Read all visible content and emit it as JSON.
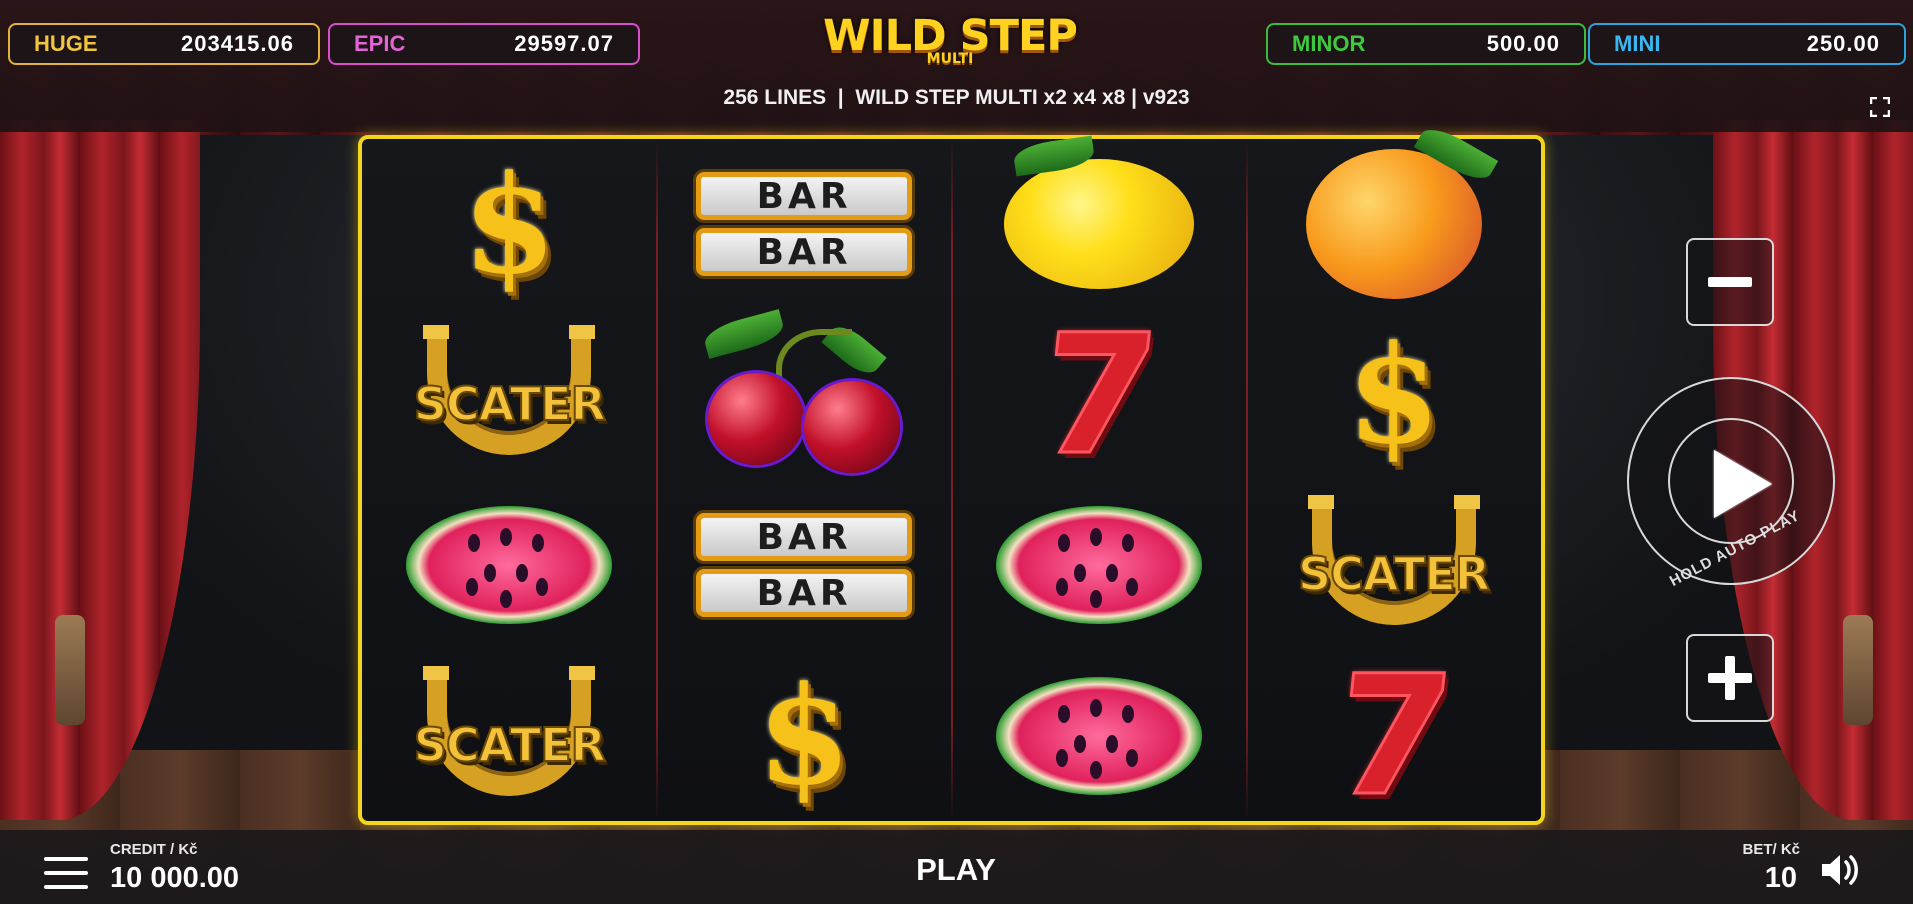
{
  "jackpots": {
    "huge": {
      "label": "HUGE",
      "value": "203415.06"
    },
    "epic": {
      "label": "EPIC",
      "value": "29597.07"
    },
    "minor": {
      "label": "MINOR",
      "value": "500.00"
    },
    "mini": {
      "label": "MINI",
      "value": "250.00"
    }
  },
  "logo": {
    "main": "WILD STEP",
    "sub": "MULTI"
  },
  "info_line": "256 LINES  |  WILD STEP MULTI x2 x4 x8 | v923",
  "grid": [
    [
      "dollar",
      "bar",
      "lemon",
      "orange"
    ],
    [
      "scatter",
      "cherry",
      "seven",
      "dollar"
    ],
    [
      "watermelon",
      "bar",
      "watermelon",
      "scatter"
    ],
    [
      "scatter",
      "dollar",
      "watermelon",
      "seven"
    ]
  ],
  "symbols": {
    "dollar": "$",
    "bar": "BAR",
    "seven": "7",
    "scatter": "SCATER"
  },
  "controls": {
    "hold_label": "HOLD AUTO PLAY",
    "play_label": "PLAY",
    "credit_label": "CREDIT / Kč",
    "credit_value": "10 000.00",
    "bet_label": "BET/ Kč",
    "bet_value": "10"
  },
  "colors": {
    "reel_border": "#f2d51c",
    "huge": "#e2b23a",
    "epic": "#d94fc9",
    "minor": "#3dbb3d",
    "mini": "#2aa4df"
  },
  "icons": [
    "fullscreen-icon",
    "minus-icon",
    "play-icon",
    "plus-icon",
    "menu-icon",
    "speaker-icon"
  ]
}
